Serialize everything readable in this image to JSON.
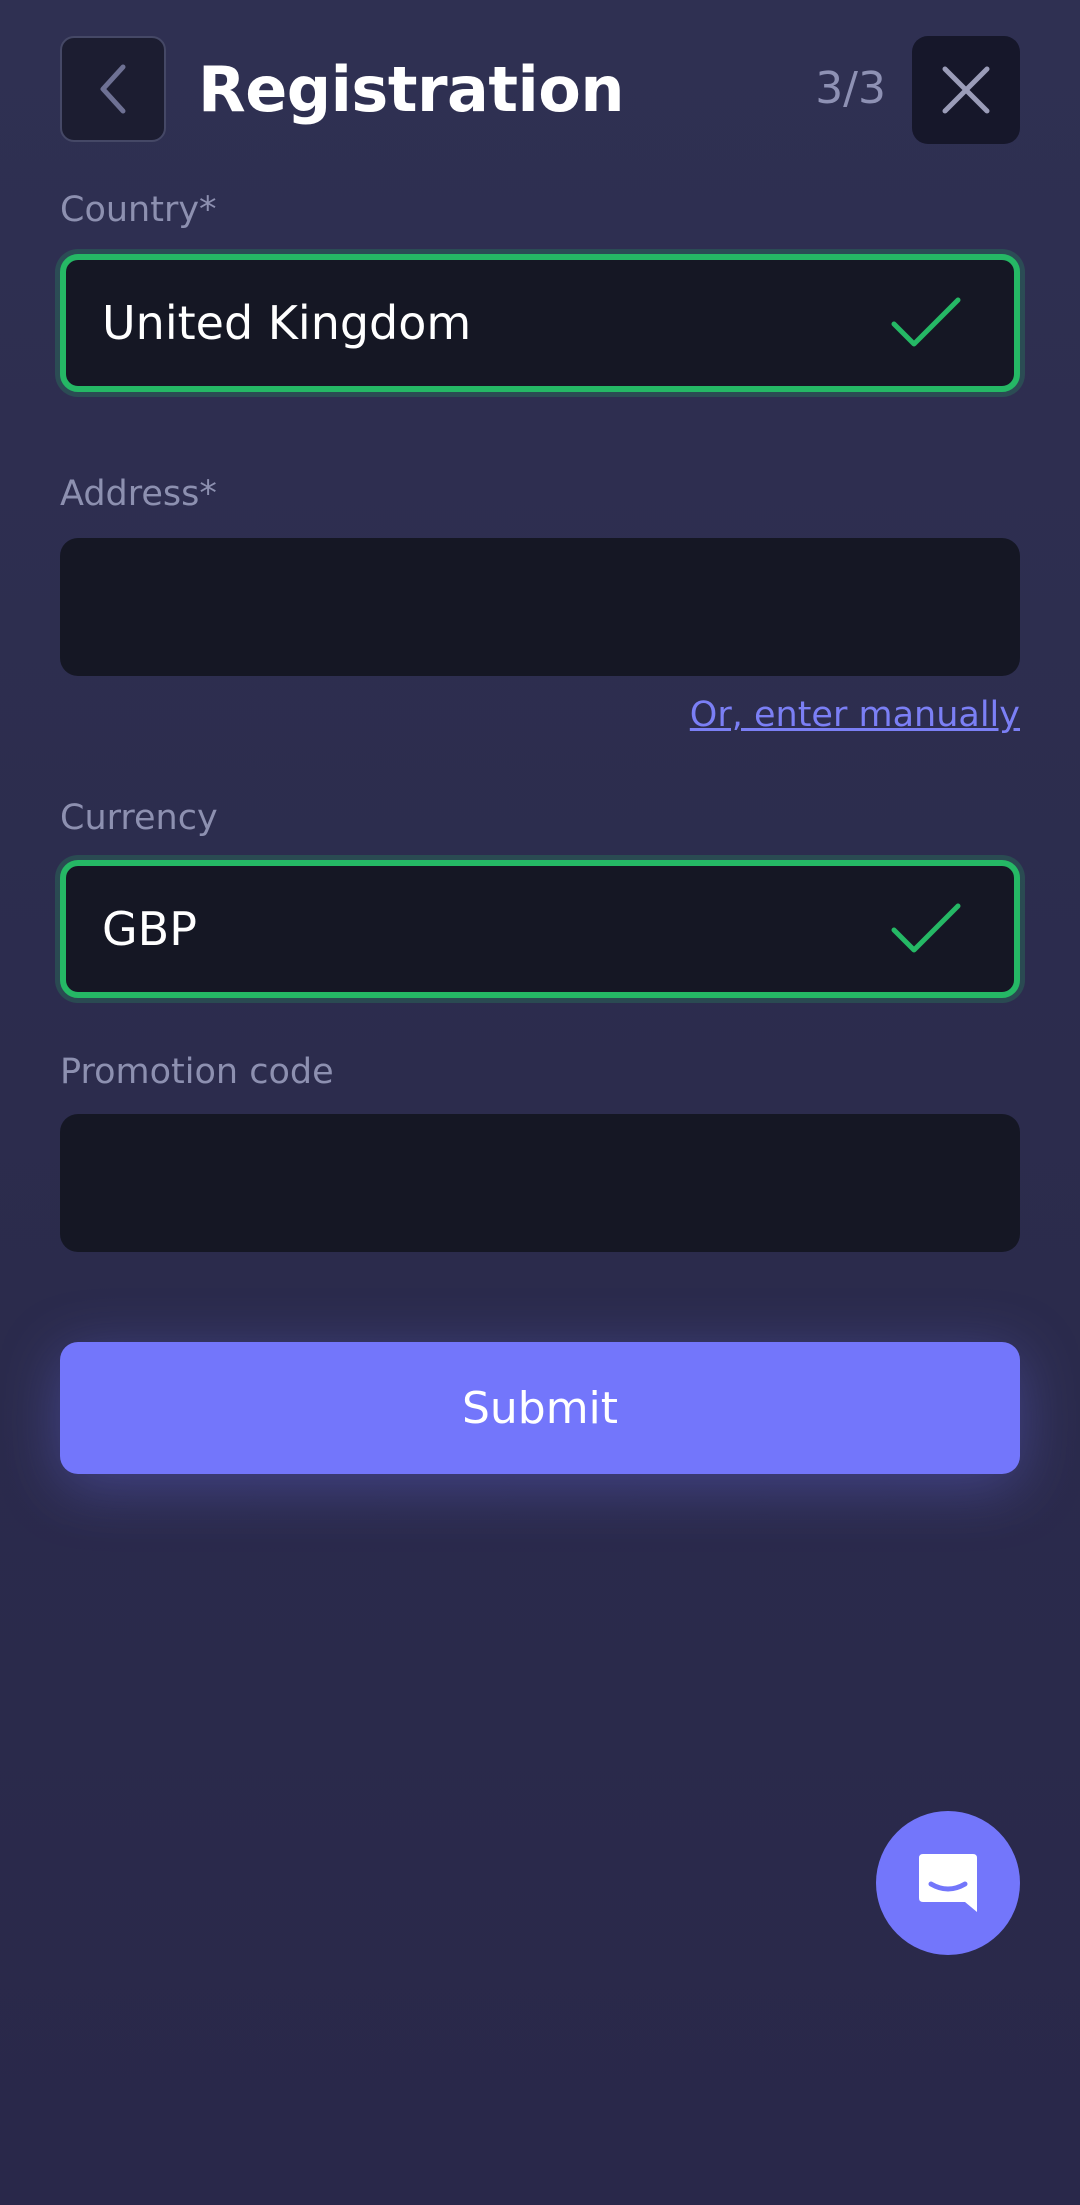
{
  "header": {
    "title": "Registration",
    "step": "3/3",
    "back_icon": "chevron-left-icon",
    "close_icon": "close-icon"
  },
  "form": {
    "country": {
      "label": "Country*",
      "value": "United Kingdom",
      "status": "valid"
    },
    "address": {
      "label": "Address*",
      "value": "",
      "manual_link": "Or, enter manually"
    },
    "currency": {
      "label": "Currency",
      "value": "GBP",
      "status": "valid"
    },
    "promo": {
      "label": "Promotion code",
      "value": ""
    },
    "submit_label": "Submit"
  },
  "chat": {
    "icon": "chat-icon"
  },
  "colors": {
    "background": "#2f3052",
    "field": "#151724",
    "valid": "#25b865",
    "accent": "#7376fb",
    "label": "#8d90b0"
  }
}
